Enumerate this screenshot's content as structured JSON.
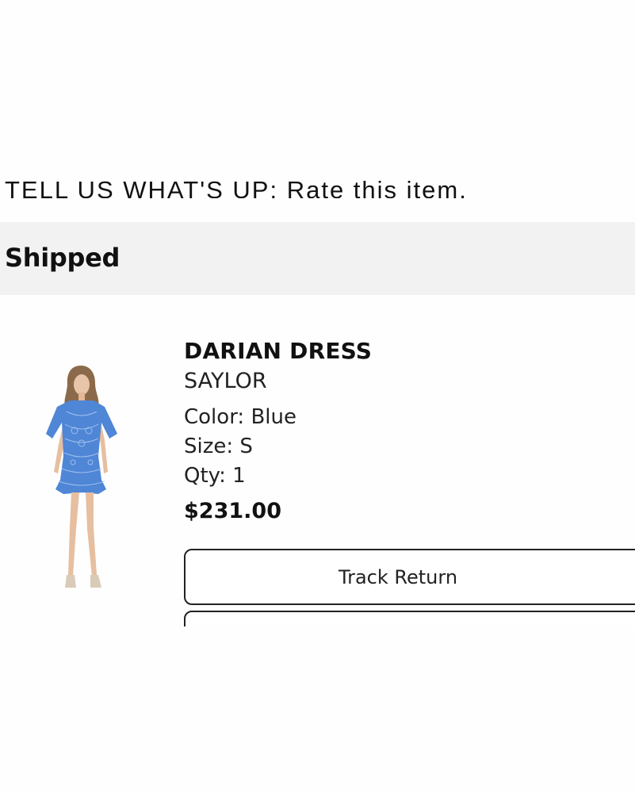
{
  "review": {
    "prompt": "TELL US WHAT'S UP:",
    "link_label": "Rate this item."
  },
  "order": {
    "status": "Shipped"
  },
  "item": {
    "name": "DARIAN DRESS",
    "brand": "SAYLOR",
    "color": "Color: Blue",
    "size": "Size: S",
    "qty": "Qty: 1",
    "price": "$231.00",
    "image_icon": "dress-product-photo",
    "dress_color": "#4f86d6"
  },
  "actions": {
    "track_return": "Track Return",
    "second_action": ""
  }
}
